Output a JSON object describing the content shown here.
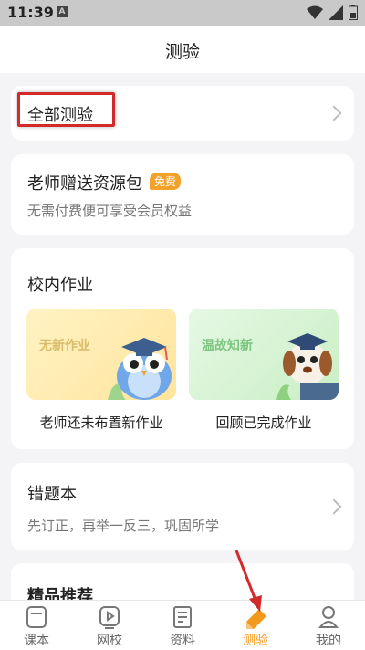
{
  "status_bar": {
    "time": "11:39",
    "notification_icon": "A"
  },
  "header": {
    "title": "测验"
  },
  "all_tests": {
    "label": "全部测验"
  },
  "teacher_gift": {
    "label": "老师赠送资源包",
    "badge": "免费",
    "subtitle": "无需付费便可享受会员权益"
  },
  "school_homework": {
    "label": "校内作业",
    "tiles": [
      {
        "title": "无新作业",
        "caption": "老师还未布置新作业"
      },
      {
        "title": "温故知新",
        "caption": "回顾已完成作业"
      }
    ]
  },
  "mistakes": {
    "label": "错题本",
    "subtitle": "先订正，再举一反三，巩固所学"
  },
  "recommend": {
    "label": "精品推荐"
  },
  "tabs": [
    {
      "label": "课本",
      "icon": "book-icon"
    },
    {
      "label": "网校",
      "icon": "video-play-icon"
    },
    {
      "label": "资料",
      "icon": "document-icon"
    },
    {
      "label": "测验",
      "icon": "pencil-icon",
      "active": true
    },
    {
      "label": "我的",
      "icon": "profile-icon"
    }
  ],
  "colors": {
    "accent": "#f39a1e",
    "highlight": "#d12a2a",
    "badge": "#f2a129"
  }
}
